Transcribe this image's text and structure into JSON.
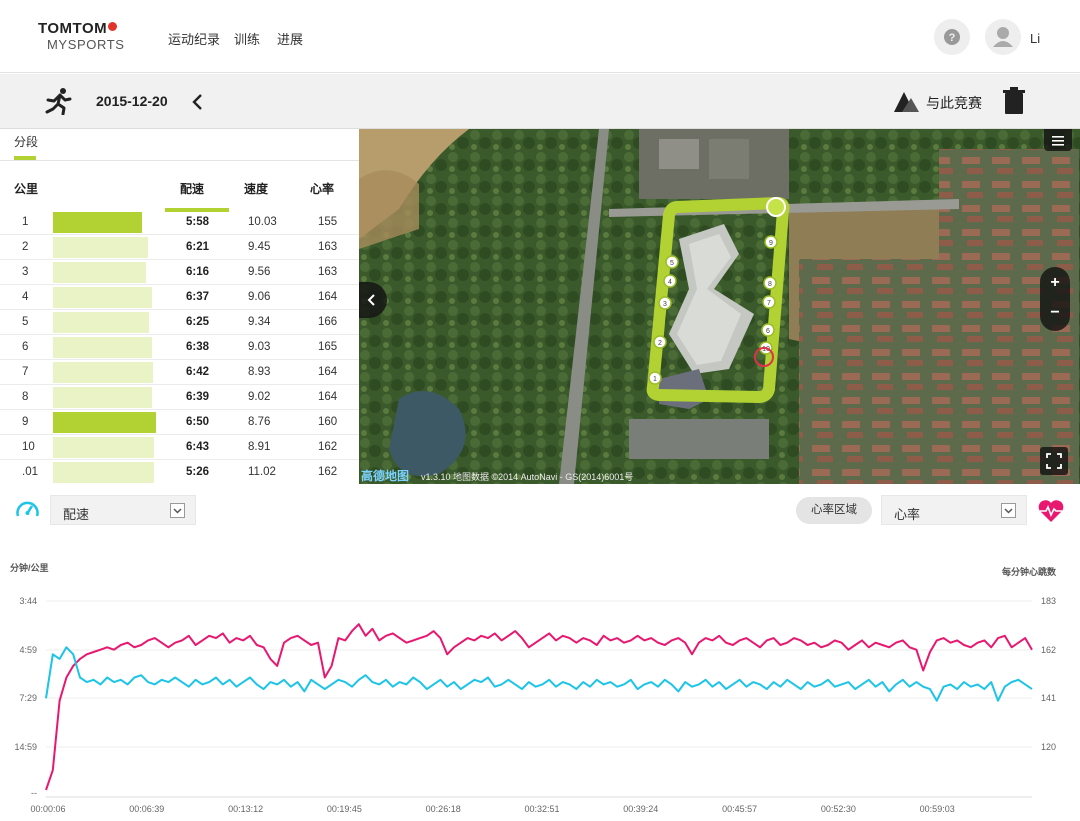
{
  "nav": {
    "logo_top": "TOMTOM",
    "logo_bottom": "MYSPORTS",
    "items": [
      "运动纪录",
      "训练",
      "进展"
    ],
    "user": "Li"
  },
  "activity": {
    "date": "2015-12-20",
    "race_label": "与此竞赛"
  },
  "splits": {
    "tab": "分段",
    "headers": {
      "km": "公里",
      "pace": "配速",
      "speed": "速度",
      "hr": "心率"
    },
    "rows": [
      {
        "km": "1",
        "pace": "5:58",
        "speed": "10.03",
        "hr": "155",
        "bar": 0.86,
        "highlight": true
      },
      {
        "km": "2",
        "pace": "6:21",
        "speed": "9.45",
        "hr": "163",
        "bar": 0.92,
        "highlight": false
      },
      {
        "km": "3",
        "pace": "6:16",
        "speed": "9.56",
        "hr": "163",
        "bar": 0.9,
        "highlight": false
      },
      {
        "km": "4",
        "pace": "6:37",
        "speed": "9.06",
        "hr": "164",
        "bar": 0.96,
        "highlight": false
      },
      {
        "km": "5",
        "pace": "6:25",
        "speed": "9.34",
        "hr": "166",
        "bar": 0.93,
        "highlight": false
      },
      {
        "km": "6",
        "pace": "6:38",
        "speed": "9.03",
        "hr": "165",
        "bar": 0.96,
        "highlight": false
      },
      {
        "km": "7",
        "pace": "6:42",
        "speed": "8.93",
        "hr": "164",
        "bar": 0.97,
        "highlight": false
      },
      {
        "km": "8",
        "pace": "6:39",
        "speed": "9.02",
        "hr": "164",
        "bar": 0.96,
        "highlight": false
      },
      {
        "km": "9",
        "pace": "6:50",
        "speed": "8.76",
        "hr": "160",
        "bar": 1.0,
        "highlight": true
      },
      {
        "km": "10",
        "pace": "6:43",
        "speed": "8.91",
        "hr": "162",
        "bar": 0.98,
        "highlight": false
      },
      {
        "km": ".01",
        "pace": "5:26",
        "speed": "11.02",
        "hr": "162",
        "bar": 0.98,
        "highlight": false
      }
    ]
  },
  "map": {
    "attribution_brand": "高德地图",
    "attribution_text": "v1.3.10 地图数据 ©2014 AutoNavi - GS(2014)6001号",
    "zoom_in": "+",
    "zoom_out": "−",
    "km_markers": [
      "1",
      "2",
      "3",
      "4",
      "5",
      "6",
      "7",
      "8",
      "9",
      "10"
    ]
  },
  "controls": {
    "left_select": "配速",
    "hr_zone_button": "心率区域",
    "right_select": "心率"
  },
  "chart_data": {
    "type": "line",
    "ylabel_left": "分钟/公里",
    "ylabel_right": "每分钟心跳数",
    "left_ticks": [
      "3:44",
      "4:59",
      "7:29",
      "14:59",
      "--"
    ],
    "right_ticks": [
      "183",
      "162",
      "141",
      "120"
    ],
    "x_ticks": [
      "00:00:06",
      "00:06:39",
      "00:13:12",
      "00:19:45",
      "00:26:18",
      "00:32:51",
      "00:39:24",
      "00:45:57",
      "00:52:30",
      "00:59:03"
    ],
    "series": [
      {
        "color": "#e8176f",
        "values": [
          85,
          110,
          140,
          150,
          155,
          158,
          160,
          161,
          162,
          163,
          162,
          164,
          165,
          163,
          164,
          166,
          167,
          165,
          163,
          165,
          166,
          168,
          164,
          166,
          168,
          167,
          169,
          165,
          167,
          166,
          168,
          164,
          163,
          158,
          155,
          165,
          167,
          168,
          166,
          164,
          165,
          150,
          155,
          167,
          166,
          170,
          173,
          168,
          171,
          166,
          168,
          169,
          167,
          165,
          166,
          167,
          168,
          170,
          167,
          160,
          163,
          165,
          167,
          166,
          168,
          167,
          169,
          166,
          168,
          170,
          167,
          163,
          165,
          167,
          169,
          166,
          168,
          167,
          165,
          167,
          166,
          164,
          168,
          166,
          167,
          165,
          166,
          168,
          166,
          167,
          165,
          164,
          166,
          167,
          165,
          160,
          165,
          167,
          166,
          168,
          165,
          164,
          166,
          167,
          165,
          163,
          166,
          167,
          164,
          165,
          167,
          166,
          164,
          165,
          163,
          164,
          166,
          165,
          162,
          164,
          166,
          163,
          165,
          164,
          163,
          165,
          166,
          163,
          162,
          153,
          161,
          166,
          167,
          165,
          166,
          164,
          163,
          165,
          166,
          163,
          167,
          168,
          163,
          165,
          167,
          162
        ]
      },
      {
        "color": "#1cc4e8",
        "values": [
          141,
          160,
          158,
          163,
          160,
          150,
          148,
          149,
          147,
          150,
          148,
          149,
          147,
          150,
          151,
          148,
          147,
          149,
          148,
          150,
          148,
          146,
          149,
          147,
          148,
          150,
          147,
          149,
          146,
          148,
          150,
          147,
          145,
          148,
          147,
          149,
          146,
          148,
          144,
          149,
          147,
          145,
          147,
          149,
          148,
          146,
          149,
          151,
          148,
          147,
          149,
          146,
          148,
          147,
          150,
          148,
          145,
          147,
          149,
          146,
          148,
          145,
          147,
          149,
          148,
          150,
          146,
          147,
          149,
          147,
          145,
          148,
          146,
          147,
          149,
          146,
          148,
          147,
          145,
          148,
          146,
          149,
          147,
          148,
          146,
          147,
          149,
          145,
          147,
          148,
          146,
          149,
          147,
          144,
          148,
          146,
          147,
          149,
          146,
          148,
          145,
          147,
          149,
          146,
          148,
          147,
          145,
          148,
          146,
          149,
          147,
          145,
          148,
          146,
          147,
          149,
          146,
          147,
          148,
          145,
          147,
          149,
          146,
          148,
          144,
          147,
          149,
          146,
          148,
          146,
          145,
          140,
          146,
          147,
          145,
          148,
          146,
          147,
          145,
          148,
          140,
          146,
          148,
          149,
          147,
          145
        ]
      }
    ]
  }
}
